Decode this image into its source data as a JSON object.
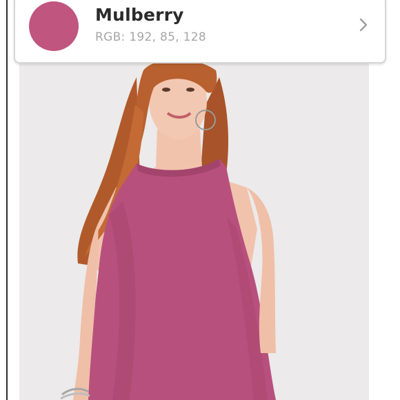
{
  "color_card": {
    "name": "Mulberry",
    "rgb_label": "RGB: 192, 85, 128",
    "swatch_color": "#c05580",
    "chevron_icon": "chevron-right-icon"
  },
  "photo": {
    "subject": "product-photo",
    "background_color": "#eceaea",
    "garment_color": "#b8507d"
  }
}
